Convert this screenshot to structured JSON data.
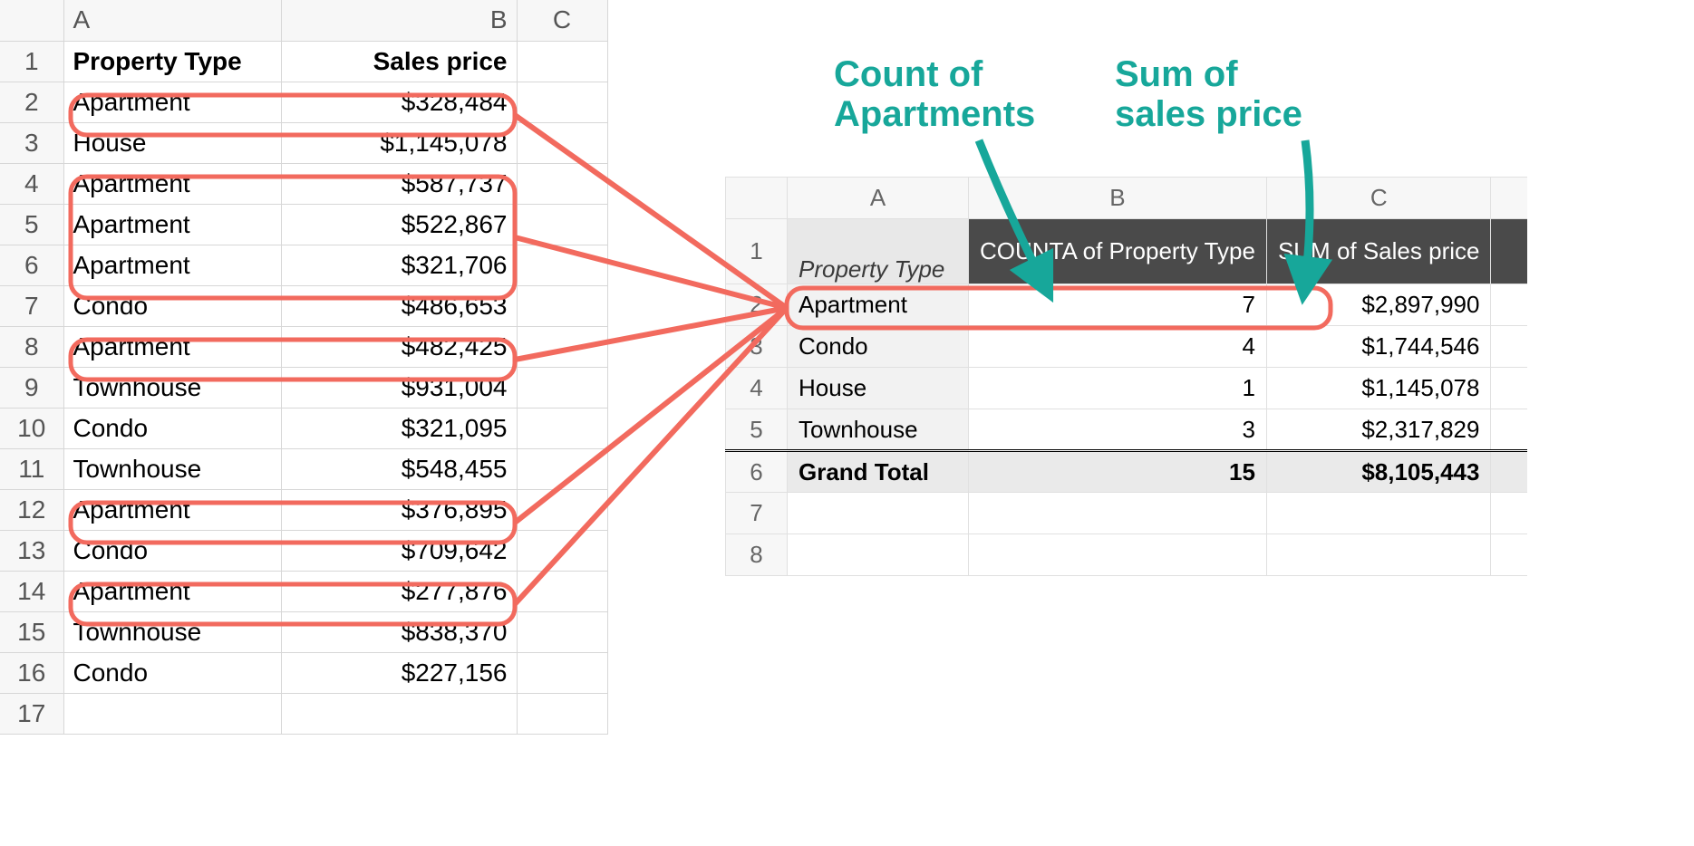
{
  "source": {
    "columns": [
      "A",
      "B",
      "C"
    ],
    "header": {
      "propType": "Property Type",
      "salesPrice": "Sales price"
    },
    "rows": [
      {
        "n": "1"
      },
      {
        "n": "2",
        "type": "Apartment",
        "price": "$328,484",
        "hl": true
      },
      {
        "n": "3",
        "type": "House",
        "price": "$1,145,078",
        "hl": false
      },
      {
        "n": "4",
        "type": "Apartment",
        "price": "$587,737",
        "hl": true
      },
      {
        "n": "5",
        "type": "Apartment",
        "price": "$522,867",
        "hl": true
      },
      {
        "n": "6",
        "type": "Apartment",
        "price": "$321,706",
        "hl": true
      },
      {
        "n": "7",
        "type": "Condo",
        "price": "$486,653",
        "hl": false
      },
      {
        "n": "8",
        "type": "Apartment",
        "price": "$482,425",
        "hl": true
      },
      {
        "n": "9",
        "type": "Townhouse",
        "price": "$931,004",
        "hl": false
      },
      {
        "n": "10",
        "type": "Condo",
        "price": "$321,095",
        "hl": false
      },
      {
        "n": "11",
        "type": "Townhouse",
        "price": "$548,455",
        "hl": false
      },
      {
        "n": "12",
        "type": "Apartment",
        "price": "$376,895",
        "hl": true
      },
      {
        "n": "13",
        "type": "Condo",
        "price": "$709,642",
        "hl": false
      },
      {
        "n": "14",
        "type": "Apartment",
        "price": "$277,876",
        "hl": true
      },
      {
        "n": "15",
        "type": "Townhouse",
        "price": "$838,370",
        "hl": false
      },
      {
        "n": "16",
        "type": "Condo",
        "price": "$227,156",
        "hl": false
      },
      {
        "n": "17"
      }
    ]
  },
  "pivot": {
    "columns": [
      "A",
      "B",
      "C"
    ],
    "headers": {
      "propType": "Property Type",
      "counta": "COUNTA of Property Type",
      "sum": "SUM of Sales price"
    },
    "rows": [
      {
        "n": "2",
        "type": "Apartment",
        "count": "7",
        "sum": "$2,897,990",
        "hl": true
      },
      {
        "n": "3",
        "type": "Condo",
        "count": "4",
        "sum": "$1,744,546"
      },
      {
        "n": "4",
        "type": "House",
        "count": "1",
        "sum": "$1,145,078"
      },
      {
        "n": "5",
        "type": "Townhouse",
        "count": "3",
        "sum": "$2,317,829"
      }
    ],
    "grandTotal": {
      "n": "6",
      "label": "Grand Total",
      "count": "15",
      "sum": "$8,105,443"
    },
    "emptyRows": [
      "7",
      "8"
    ]
  },
  "callouts": {
    "countLabel": "Count of\nApartments",
    "sumLabel": "Sum of\nsales price"
  }
}
